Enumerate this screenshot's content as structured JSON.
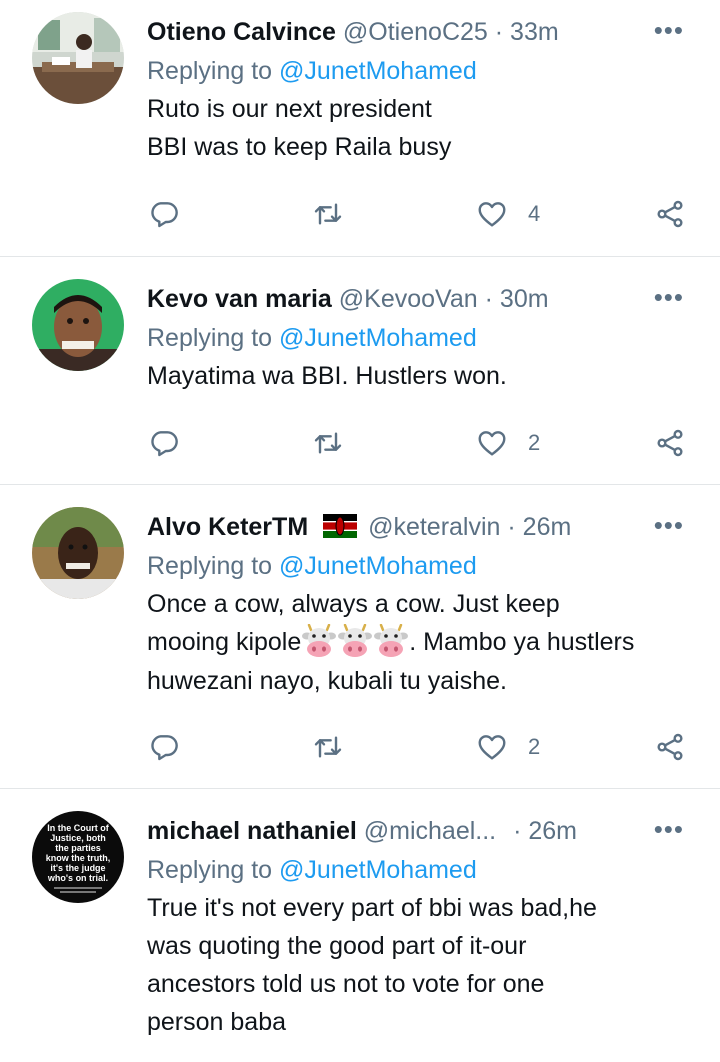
{
  "tweets": [
    {
      "name": "Otieno Calvince",
      "handle": "@OtienoC25",
      "dot": "·",
      "time": "33m",
      "replying_prefix": "Replying to",
      "replying_to": "@JunetMohamed",
      "lines": [
        "Ruto is our next president",
        "BBI was to keep Raila busy"
      ],
      "like_count": "4"
    },
    {
      "name": "Kevo van maria",
      "handle": "@KevooVan",
      "dot": "·",
      "time": "30m",
      "replying_prefix": "Replying to",
      "replying_to": "@JunetMohamed",
      "lines": [
        "Mayatima wa BBI. Hustlers won."
      ],
      "like_count": "2"
    },
    {
      "name": "Alvo Keter",
      "name_suffix": "TM",
      "handle": "@keteralvin",
      "dot": "·",
      "time": "26m",
      "replying_prefix": "Replying to",
      "replying_to": "@JunetMohamed",
      "line1": "Once a cow, always a cow. Just keep",
      "line2_start": "mooing kipole",
      "line2_end": ". Mambo ya hustlers",
      "line3": "huwezani nayo, kubali tu yaishe.",
      "like_count": "2"
    },
    {
      "name": "michael nathaniel",
      "handle": "@michael...",
      "dot": "·",
      "time": "26m",
      "replying_prefix": "Replying to",
      "replying_to": "@JunetMohamed",
      "lines": [
        "True it's not every part of bbi was bad,he",
        "was quoting the good part of it-our",
        "ancestors told us not to vote for one",
        "person baba"
      ],
      "avatar_text": [
        "In the Court of",
        "Justice, both",
        "the parties",
        "know the truth,",
        "it's the judge",
        "who's on trial."
      ]
    }
  ],
  "more_icon": "•••",
  "icons": [
    "reply-icon",
    "retweet-icon",
    "like-icon",
    "share-icon",
    "more-icon",
    "kenya-flag-icon",
    "cow-face-icon"
  ],
  "colors": {
    "accent": "#1d9bf0",
    "secondary_text": "#5b7083",
    "divider": "#e3e6e8"
  }
}
